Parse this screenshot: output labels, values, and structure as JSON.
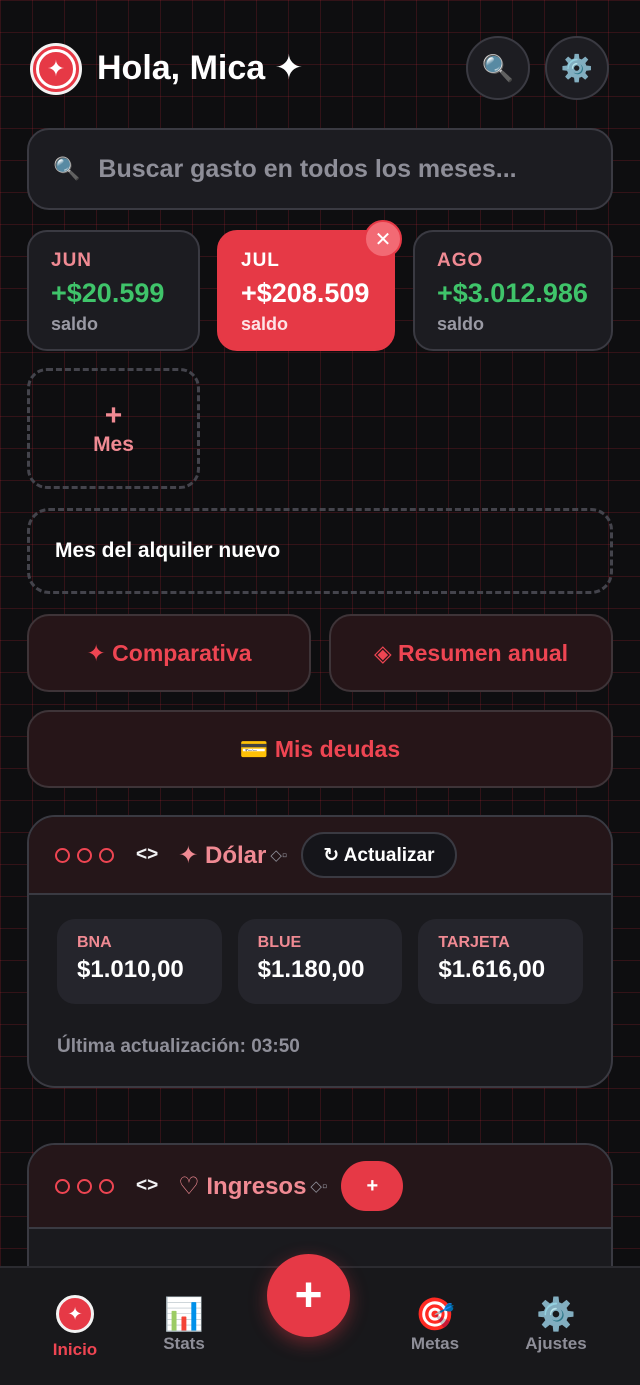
{
  "header": {
    "greeting": "Hola, Mica ✦",
    "logo_glyph": "✦",
    "search_icon": "🔍",
    "settings_icon": "⚙️"
  },
  "search": {
    "icon": "🔍",
    "placeholder": "Buscar gasto en todos los meses..."
  },
  "months": [
    {
      "name": "JUN",
      "amount": "+$20.599",
      "label": "saldo"
    },
    {
      "name": "JUL",
      "amount": "+$208.509",
      "label": "saldo"
    },
    {
      "name": "AGO",
      "amount": "+$3.012.986",
      "label": "saldo"
    }
  ],
  "close_glyph": "✕",
  "add_month": {
    "plus": "+",
    "label": "Mes"
  },
  "note": "Mes del alquiler nuevo",
  "actions": {
    "comparativa": "✦ Comparativa",
    "resumen": "◈ Resumen anual",
    "deudas": "💳 Mis deudas"
  },
  "dolar_panel": {
    "code": "<>",
    "title": "✦ Dólar",
    "tag": "◇▫",
    "refresh": "↻ Actualizar",
    "rates": [
      {
        "name": "BNA",
        "value": "$1.010,00"
      },
      {
        "name": "BLUE",
        "value": "$1.180,00"
      },
      {
        "name": "TARJETA",
        "value": "$1.616,00"
      }
    ],
    "updated": "Última actualización: 03:50"
  },
  "ingresos_panel": {
    "code": "<>",
    "title": "♡ Ingresos",
    "tag": "◇▫",
    "add": "+"
  },
  "nav": {
    "inicio": "Inicio",
    "stats": "Stats",
    "metas": "Metas",
    "ajustes": "Ajustes",
    "stats_icon": "📊",
    "metas_icon": "🎯",
    "ajustes_icon": "⚙️",
    "fab": "+"
  },
  "colors": {
    "accent": "#e63946",
    "positive": "#3fc46a",
    "background": "#0e0e10"
  }
}
